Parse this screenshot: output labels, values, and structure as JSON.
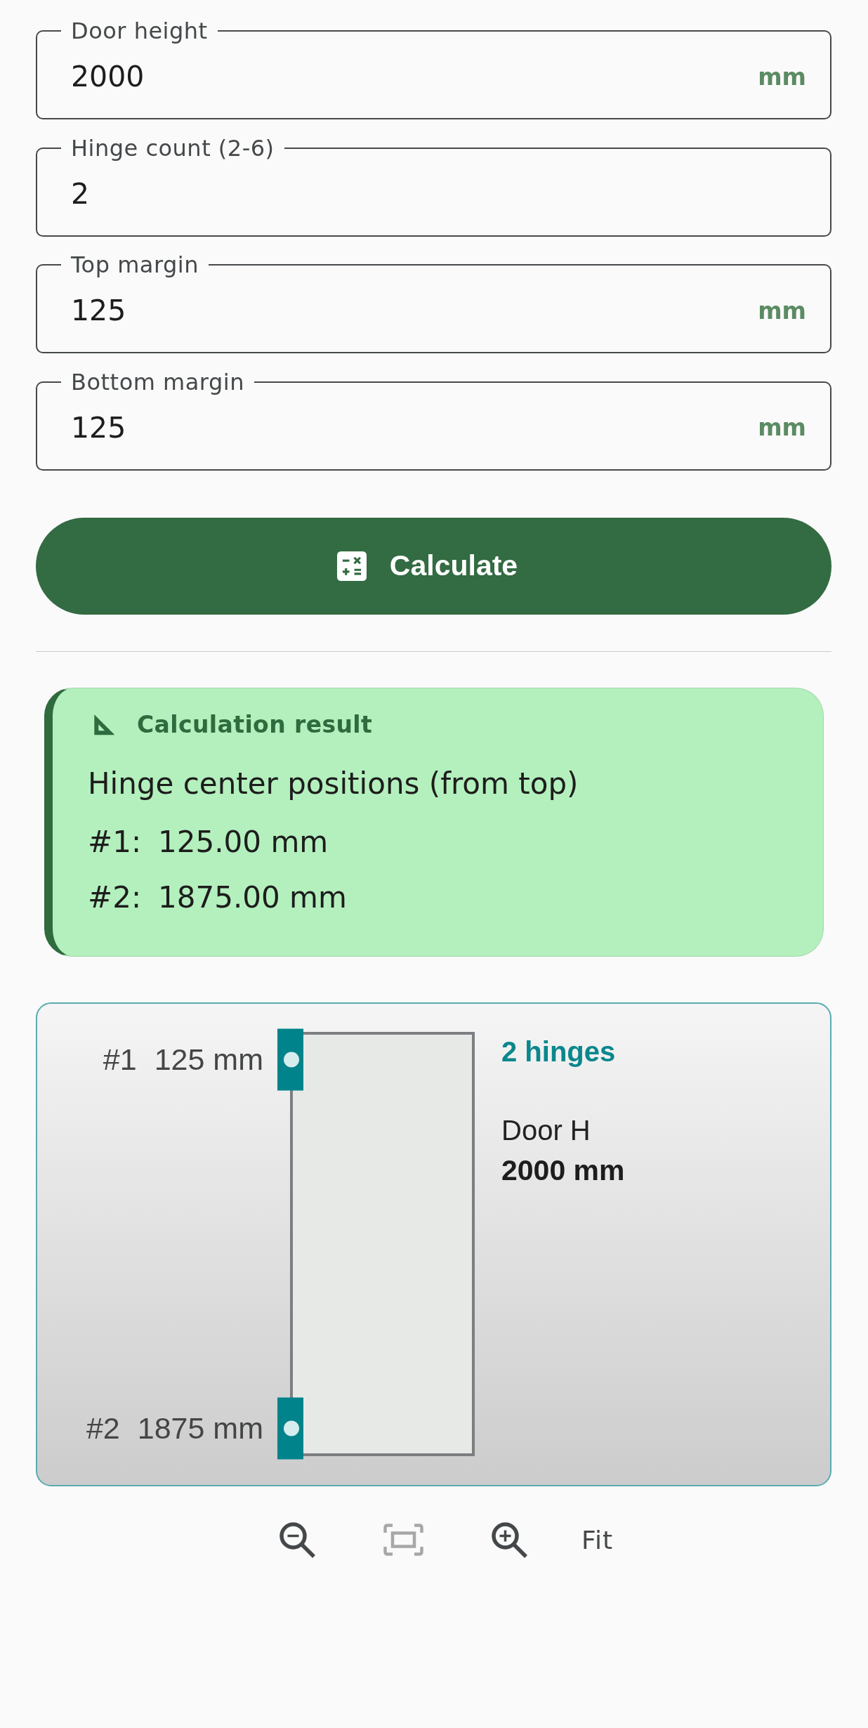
{
  "form": {
    "fields": [
      {
        "label": "Door height",
        "value": "2000",
        "suffix": "mm"
      },
      {
        "label": "Hinge count (2-6)",
        "value": "2"
      },
      {
        "label": "Top margin",
        "value": "125",
        "suffix": "mm"
      },
      {
        "label": "Bottom margin",
        "value": "125",
        "suffix": "mm"
      }
    ]
  },
  "calculate_button": {
    "label": "Calculate"
  },
  "result": {
    "title": "Calculation result",
    "subtitle": "Hinge center positions (from top)",
    "positions": [
      {
        "label": "#1:",
        "value": "125.00 mm"
      },
      {
        "label": "#2:",
        "value": "1875.00 mm"
      }
    ]
  },
  "diagram": {
    "hinges": [
      {
        "label": "#1",
        "distance": "125 mm"
      },
      {
        "label": "#2",
        "distance": "1875 mm"
      }
    ],
    "summary": "2 hinges",
    "door_label": "Door H",
    "door_height": "2000 mm"
  },
  "zoom_controls": {
    "buttons": [
      {
        "kind": "zoom-out",
        "disabled": false
      },
      {
        "kind": "fit-screen",
        "disabled": true
      },
      {
        "kind": "zoom-in",
        "disabled": false
      }
    ],
    "fit_label": "Fit"
  }
}
